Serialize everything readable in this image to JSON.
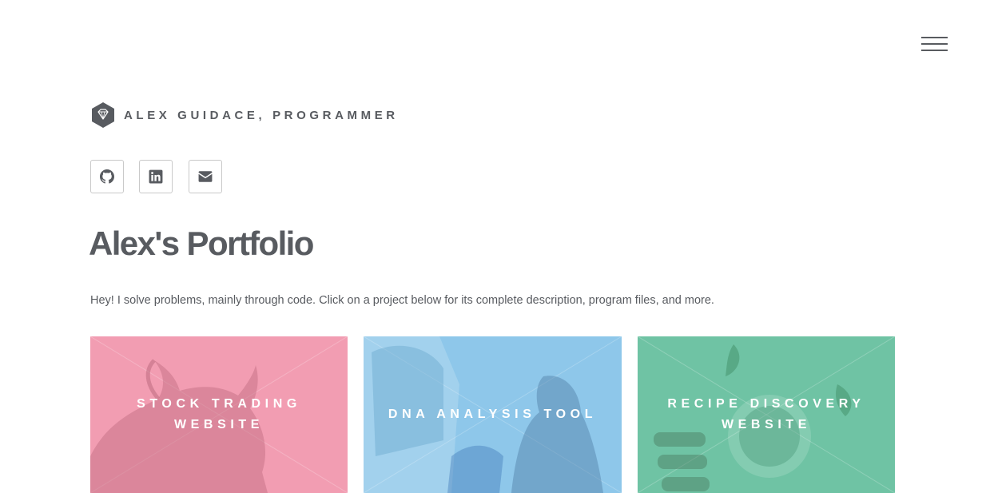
{
  "header": {
    "menu_icon": "hamburger-menu-icon",
    "logo_icon": "diamond-icon",
    "site_name": "ALEX GUIDACE, PROGRAMMER"
  },
  "social": [
    {
      "icon": "github-icon"
    },
    {
      "icon": "linkedin-icon"
    },
    {
      "icon": "envelope-icon"
    }
  ],
  "main": {
    "title": "Alex's Portfolio",
    "intro": "Hey! I solve problems, mainly through code. Click on a project below for its complete description, program files, and more."
  },
  "projects": [
    {
      "title": "STOCK TRADING WEBSITE",
      "color": "#f29db2"
    },
    {
      "title": "DNA ANALYSIS TOOL",
      "color": "#8ec7ea"
    },
    {
      "title": "RECIPE DISCOVERY WEBSITE",
      "color": "#6fc3a4"
    }
  ],
  "colors": {
    "text": "#585b60",
    "border": "#c9c9c9",
    "background": "#ffffff"
  }
}
